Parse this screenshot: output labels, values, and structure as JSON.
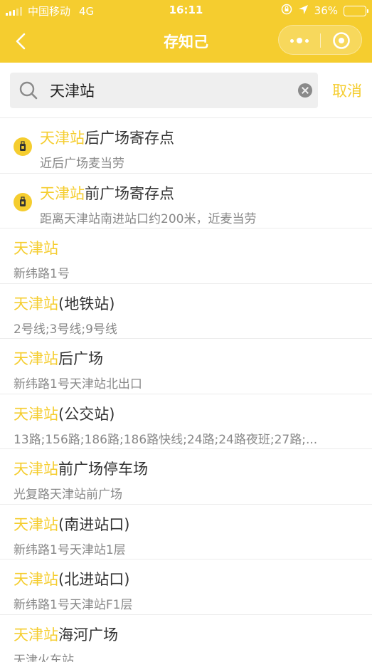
{
  "status_bar": {
    "carrier": "中国移动",
    "network": "4G",
    "time": "16:11",
    "battery": "36%",
    "battery_level": 0.36
  },
  "nav": {
    "title": "存知己"
  },
  "search": {
    "value": "天津站",
    "cancel_label": "取消"
  },
  "colors": {
    "accent": "#f5cd2f",
    "highlight_text": "#f5cd2f"
  },
  "results": [
    {
      "highlight": "天津站",
      "rest": "后广场寄存点",
      "sub": "近后广场麦当劳",
      "icon": "luggage-icon"
    },
    {
      "highlight": "天津站",
      "rest": "前广场寄存点",
      "sub": "距离天津站南进站口约200米，近麦当劳",
      "icon": "luggage-icon"
    },
    {
      "highlight": "天津站",
      "rest": "",
      "sub": "新纬路1号"
    },
    {
      "highlight": "天津站",
      "rest": "(地铁站)",
      "sub": "2号线;3号线;9号线"
    },
    {
      "highlight": "天津站",
      "rest": "后广场",
      "sub": "新纬路1号天津站北出口"
    },
    {
      "highlight": "天津站",
      "rest": "(公交站)",
      "sub": "13路;156路;186路;186路快线;24路;24路夜班;27路;..."
    },
    {
      "highlight": "天津站",
      "rest": "前广场停车场",
      "sub": "光复路天津站前广场"
    },
    {
      "highlight": "天津站",
      "rest": "(南进站口)",
      "sub": "新纬路1号天津站1层"
    },
    {
      "highlight": "天津站",
      "rest": "(北进站口)",
      "sub": "新纬路1号天津站F1层"
    },
    {
      "highlight": "天津站",
      "rest": "海河广场",
      "sub": "天津火车站"
    }
  ]
}
